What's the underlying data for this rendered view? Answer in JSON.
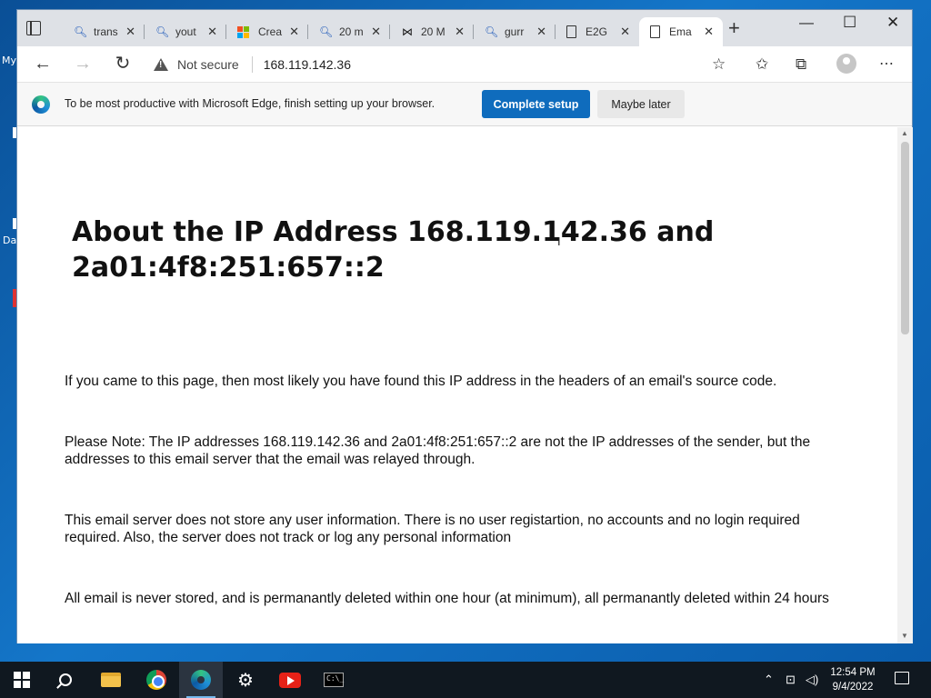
{
  "desktop": {
    "labels": [
      "My",
      "Da"
    ]
  },
  "browser": {
    "tabs": [
      {
        "icon": "search-icon",
        "label": "trans"
      },
      {
        "icon": "search-icon",
        "label": "yout"
      },
      {
        "icon": "microsoft-logo-icon",
        "label": "Crea"
      },
      {
        "icon": "search-icon",
        "label": "20 m"
      },
      {
        "icon": "bowtie-icon",
        "label": "20 M"
      },
      {
        "icon": "search-icon",
        "label": "gurr"
      },
      {
        "icon": "document-icon",
        "label": "E2G"
      },
      {
        "icon": "document-icon",
        "label": "Ema",
        "active": true
      }
    ],
    "address": {
      "security_label": "Not secure",
      "url": "168.119.142.36"
    },
    "infobar": {
      "message": "To be most productive with Microsoft Edge, finish setting up your browser.",
      "primary_button": "Complete setup",
      "secondary_button": "Maybe later"
    }
  },
  "page": {
    "title": "About the IP Address 168.119.142.36 and 2a01:4f8:251:657::2",
    "paragraphs": [
      "If you came to this page, then most likely you have found this IP address in the headers of an email's source code.",
      "Please Note: The IP addresses 168.119.142.36 and 2a01:4f8:251:657::2 are not the IP addresses of the sender, but the addresses to this email server that the email was relayed through.",
      "This email server does not store any user information. There is no user registartion, no accounts and no login required required. Also, the server does not track or log any personal information",
      "All email is never stored, and is permanantly deleted within one hour (at minimum), all permanantly deleted within 24 hours"
    ]
  },
  "taskbar": {
    "time": "12:54 PM",
    "date": "9/4/2022"
  },
  "colors": {
    "accent": "#0f6cbd",
    "desktop": "#0b5fa8",
    "taskbar": "#101820"
  }
}
